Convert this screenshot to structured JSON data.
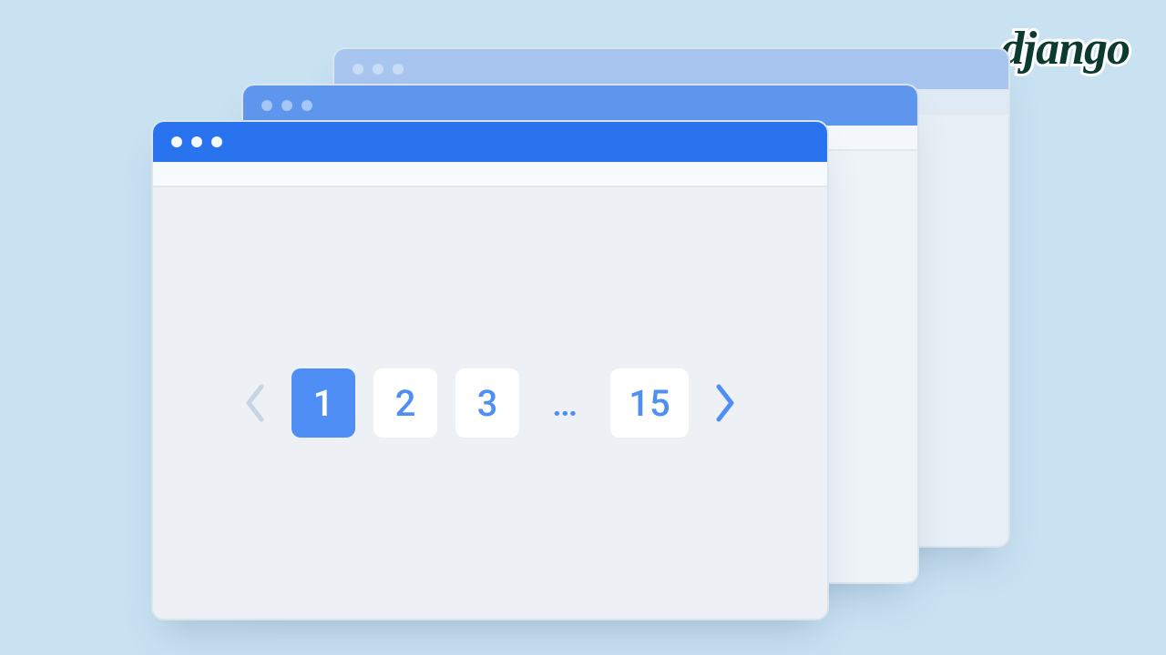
{
  "logo": {
    "text": "django"
  },
  "pagination": {
    "pages": [
      "1",
      "2",
      "3"
    ],
    "ellipsis": "…",
    "last_page": "15",
    "active_index": 0
  }
}
